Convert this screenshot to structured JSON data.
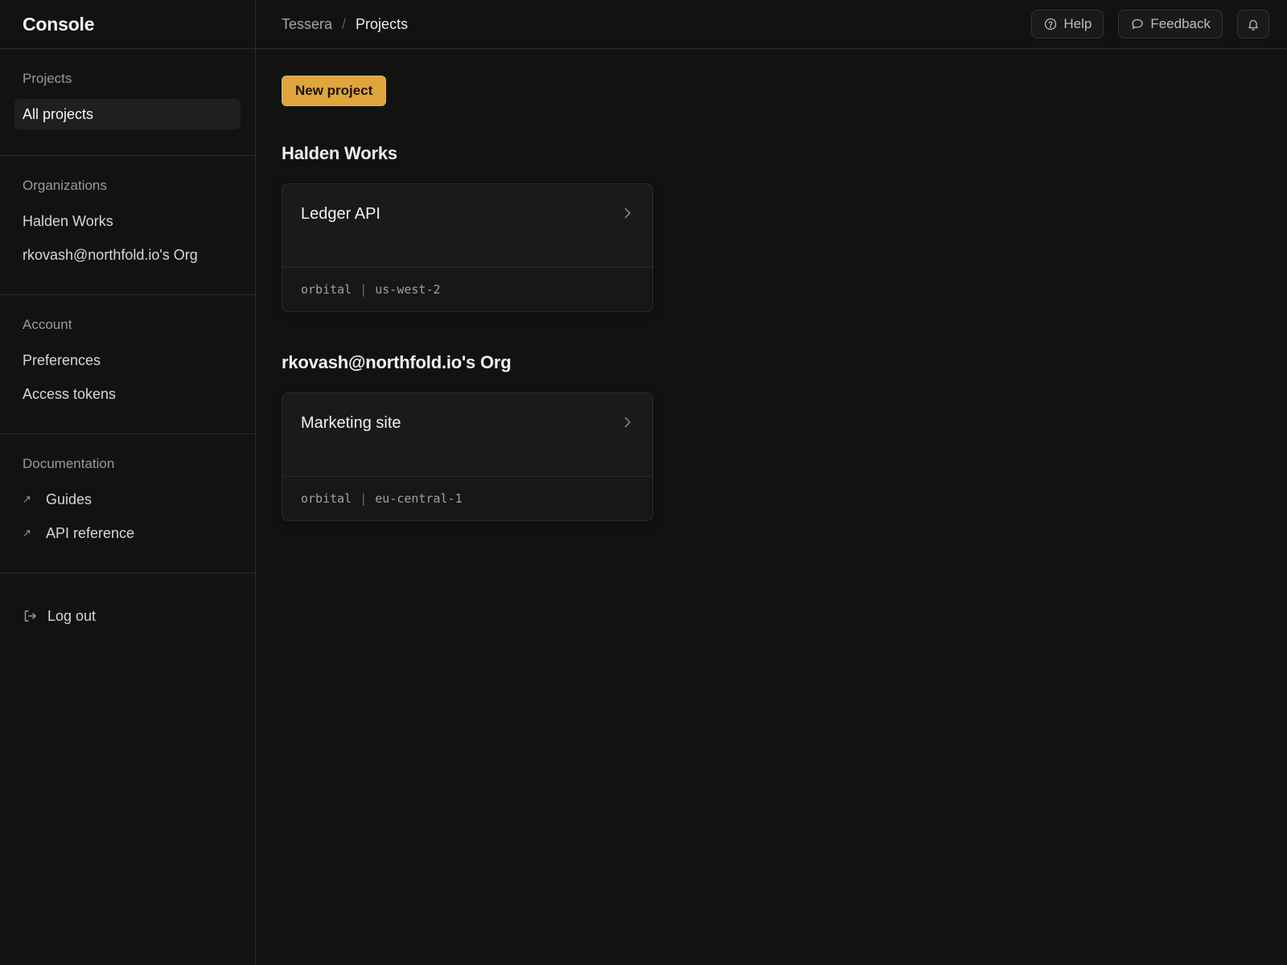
{
  "app": {
    "title": "Console"
  },
  "breadcrumb": {
    "root": "Tessera",
    "separator": "/",
    "current": "Projects"
  },
  "header": {
    "help_label": "Help",
    "feedback_label": "Feedback",
    "notifications_icon": "bell-icon"
  },
  "sidebar": {
    "projects": {
      "heading": "Projects",
      "items": [
        {
          "label": "All projects",
          "active": true
        }
      ]
    },
    "organizations": {
      "heading": "Organizations",
      "items": [
        {
          "label": "Halden Works"
        },
        {
          "label": "rkovash@northfold.io's Org"
        }
      ]
    },
    "account": {
      "heading": "Account",
      "items": [
        {
          "label": "Preferences"
        },
        {
          "label": "Access tokens"
        }
      ]
    },
    "documentation": {
      "heading": "Documentation",
      "items": [
        {
          "label": "Guides",
          "icon": "↗"
        },
        {
          "label": "API reference",
          "icon": "↗"
        }
      ]
    },
    "logout": {
      "label": "Log out"
    }
  },
  "main": {
    "new_project_label": "New project",
    "accent_color": "#e0a53d",
    "orgs": [
      {
        "name": "Halden Works",
        "projects": [
          {
            "name": "Ledger API",
            "provider": "orbital",
            "separator": "|",
            "region": "us-west-2"
          }
        ]
      },
      {
        "name": "rkovash@northfold.io's Org",
        "projects": [
          {
            "name": "Marketing site",
            "provider": "orbital",
            "separator": "|",
            "region": "eu-central-1"
          }
        ]
      }
    ]
  }
}
